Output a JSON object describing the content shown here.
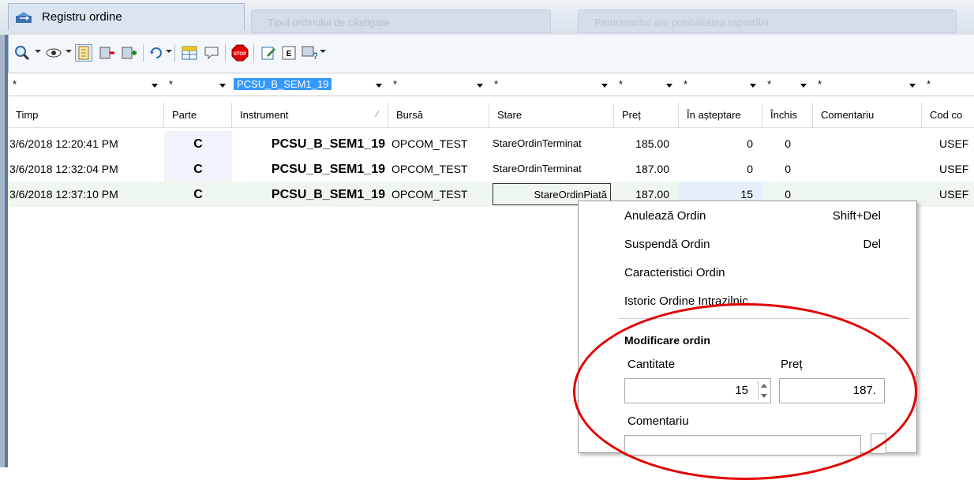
{
  "window": {
    "title": "Registru ordine",
    "bg_tab_1": "Tipul ordinului de câștigare",
    "bg_tab_2": "Participantul are posibilitatea raportării"
  },
  "toolbar": {
    "icons": [
      "search-icon",
      "eye-icon",
      "order-book-icon",
      "sell-icon",
      "buy-icon",
      "refresh-icon",
      "grid-icon",
      "comment-icon",
      "stop-icon",
      "edit-icon",
      "export-icon",
      "help-icon"
    ]
  },
  "filters": [
    "*",
    "*",
    "PCSU_B_SEM1_19",
    "*",
    "*",
    "*",
    "*",
    "*",
    "*",
    "*"
  ],
  "columns": [
    "Timp",
    "Parte",
    "Instrument",
    "Bursă",
    "Stare",
    "Preț",
    "În așteptare",
    "Închis",
    "Comentariu",
    "Cod co"
  ],
  "rows": [
    {
      "timp": "3/6/2018 12:20:41 PM",
      "parte": "C",
      "instrument": "PCSU_B_SEM1_19",
      "bursa": "OPCOM_TEST",
      "stare": "StareOrdinTerminat",
      "pret": "185.00",
      "asteptare": "0",
      "inchis": "0",
      "comentariu": "",
      "cod": "USEF"
    },
    {
      "timp": "3/6/2018 12:32:04 PM",
      "parte": "C",
      "instrument": "PCSU_B_SEM1_19",
      "bursa": "OPCOM_TEST",
      "stare": "StareOrdinTerminat",
      "pret": "187.00",
      "asteptare": "0",
      "inchis": "0",
      "comentariu": "",
      "cod": "USEF"
    },
    {
      "timp": "3/6/2018 12:37:10 PM",
      "parte": "C",
      "instrument": "PCSU_B_SEM1_19",
      "bursa": "OPCOM_TEST",
      "stare": "StareOrdinPiată",
      "pret": "187.00",
      "asteptare": "15",
      "inchis": "0",
      "comentariu": "",
      "cod": "USEF"
    }
  ],
  "context_menu": {
    "items": [
      {
        "label": "Anulează Ordin",
        "shortcut": "Shift+Del"
      },
      {
        "label": "Suspendă Ordin",
        "shortcut": "Del"
      },
      {
        "label": "Caracteristici Ordin",
        "shortcut": ""
      },
      {
        "label": "Istoric Ordine Intrazilnic",
        "shortcut": ""
      }
    ],
    "modify": {
      "title": "Modificare ordin",
      "quantity_label": "Cantitate",
      "quantity_value": "15",
      "price_label": "Preț",
      "price_value": "187.",
      "comment_label": "Comentariu",
      "comment_value": ""
    }
  },
  "colors": {
    "annotation": "#e00000",
    "filter_highlight": "#3399ff"
  }
}
